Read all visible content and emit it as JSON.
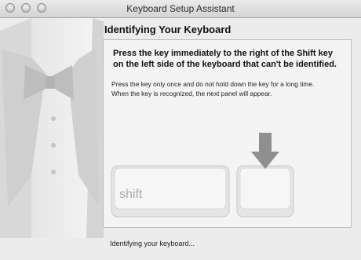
{
  "window": {
    "title": "Keyboard Setup Assistant"
  },
  "header": {
    "heading": "Identifying Your Keyboard"
  },
  "panel": {
    "instruction": "Press the key immediately to the right of the Shift key on the left side of the keyboard that can't be identified.",
    "note_line1": "Press the key only once and do not hold down the key for a long time.",
    "note_line2": "When the key is recognized, the next panel will appear.",
    "shift_key_label": "shift"
  },
  "footer": {
    "status": "Identifying your keyboard..."
  }
}
